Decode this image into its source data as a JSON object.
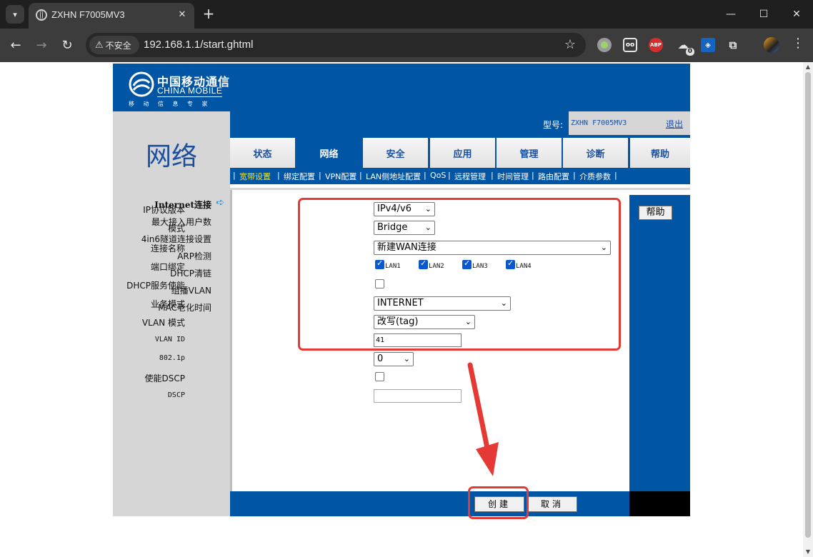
{
  "browser": {
    "tab_title": "ZXHN F7005MV3",
    "url": "192.168.1.1/start.ghtml",
    "security_label": "不安全",
    "extension_badge": "0"
  },
  "router": {
    "logo": {
      "cn": "中国移动通信",
      "en": "CHINA MOBILE",
      "sub": "移动信息专家"
    },
    "section_title": "网络",
    "model_label": "型号:",
    "model_value": "ZXHN F7005MV3",
    "logout": "退出",
    "main_tabs": [
      {
        "label": "状态",
        "active": false
      },
      {
        "label": "网络",
        "active": true
      },
      {
        "label": "安全",
        "active": false
      },
      {
        "label": "应用",
        "active": false
      },
      {
        "label": "管理",
        "active": false
      },
      {
        "label": "诊断",
        "active": false
      },
      {
        "label": "帮助",
        "active": false
      }
    ],
    "sub_nav": [
      "宽带设置",
      "绑定配置",
      "VPN配置",
      "LAN侧地址配置",
      "QoS",
      "远程管理",
      "时间管理",
      "路由配置",
      "介质参数"
    ],
    "left_menu": [
      "Internet连接",
      "最大接入用户数",
      "4in6隧道连接设置",
      "ARP检测",
      "DHCP清链",
      "组播VLAN",
      "MAC老化时间"
    ],
    "help_button": "帮助",
    "form": {
      "ip_version": {
        "label": "IP协议版本",
        "value": "IPv4/v6"
      },
      "mode": {
        "label": "模式",
        "value": "Bridge"
      },
      "connection_name": {
        "label": "连接名称",
        "value": "新建WAN连接"
      },
      "port_binding": {
        "label": "端口绑定",
        "ports": [
          {
            "name": "LAN1",
            "checked": true
          },
          {
            "name": "LAN2",
            "checked": true
          },
          {
            "name": "LAN3",
            "checked": true
          },
          {
            "name": "LAN4",
            "checked": true
          }
        ]
      },
      "dhcp_service": {
        "label": "DHCP服务使能",
        "checked": false
      },
      "service_mode": {
        "label": "业务模式",
        "value": "INTERNET"
      },
      "vlan_mode": {
        "label": "VLAN 模式",
        "value": "改写(tag)"
      },
      "vlan_id": {
        "label": "VLAN ID",
        "value": "41"
      },
      "priority_8021p": {
        "label": "802.1p",
        "value": "0"
      },
      "enable_dscp": {
        "label": "使能DSCP",
        "checked": false
      },
      "dscp": {
        "label": "DSCP",
        "value": ""
      }
    },
    "buttons": {
      "create": "创建",
      "cancel": "取消"
    }
  },
  "colors": {
    "brand_blue": "#0055a5",
    "panel_gray": "#d6d6d6",
    "annotation_red": "#e53935",
    "active_subnav": "#ffe400"
  }
}
